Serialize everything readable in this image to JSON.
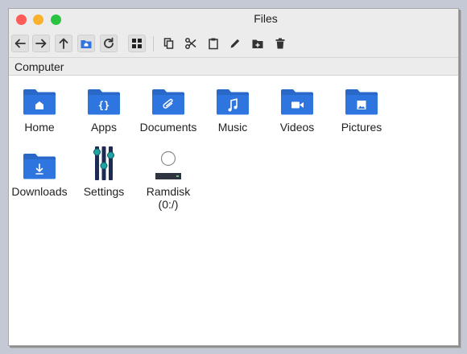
{
  "window": {
    "title": "Files"
  },
  "toolbar": {
    "buttons": [
      {
        "name": "back-button",
        "icon": "arrow-left-icon"
      },
      {
        "name": "forward-button",
        "icon": "arrow-right-icon"
      },
      {
        "name": "up-button",
        "icon": "arrow-up-icon"
      },
      {
        "name": "home-button",
        "icon": "home-folder-icon"
      },
      {
        "name": "refresh-button",
        "icon": "refresh-icon"
      },
      {
        "name": "view-mode-button",
        "icon": "grid-view-icon"
      },
      {
        "name": "copy-button",
        "icon": "copy-icon"
      },
      {
        "name": "cut-button",
        "icon": "scissors-icon"
      },
      {
        "name": "paste-button",
        "icon": "clipboard-icon"
      },
      {
        "name": "rename-button",
        "icon": "pencil-icon"
      },
      {
        "name": "new-folder-button",
        "icon": "folder-plus-icon"
      },
      {
        "name": "delete-button",
        "icon": "trash-icon"
      }
    ]
  },
  "path": {
    "label": "Computer"
  },
  "items": [
    {
      "label": "Home",
      "icon": "home-folder-icon"
    },
    {
      "label": "Apps",
      "icon": "apps-folder-icon"
    },
    {
      "label": "Documents",
      "icon": "documents-folder-icon"
    },
    {
      "label": "Music",
      "icon": "music-folder-icon"
    },
    {
      "label": "Videos",
      "icon": "videos-folder-icon"
    },
    {
      "label": "Pictures",
      "icon": "pictures-folder-icon"
    },
    {
      "label": "Downloads",
      "icon": "downloads-folder-icon"
    },
    {
      "label": "Settings",
      "icon": "settings-sliders-icon"
    },
    {
      "label": "Ramdisk (0:/)",
      "icon": "drive-icon"
    }
  ],
  "colors": {
    "folder": "#2f75df",
    "folder_tab": "#2a68c8",
    "accent_teal": "#1fa3a3",
    "desktop": "#c5c9d6"
  }
}
